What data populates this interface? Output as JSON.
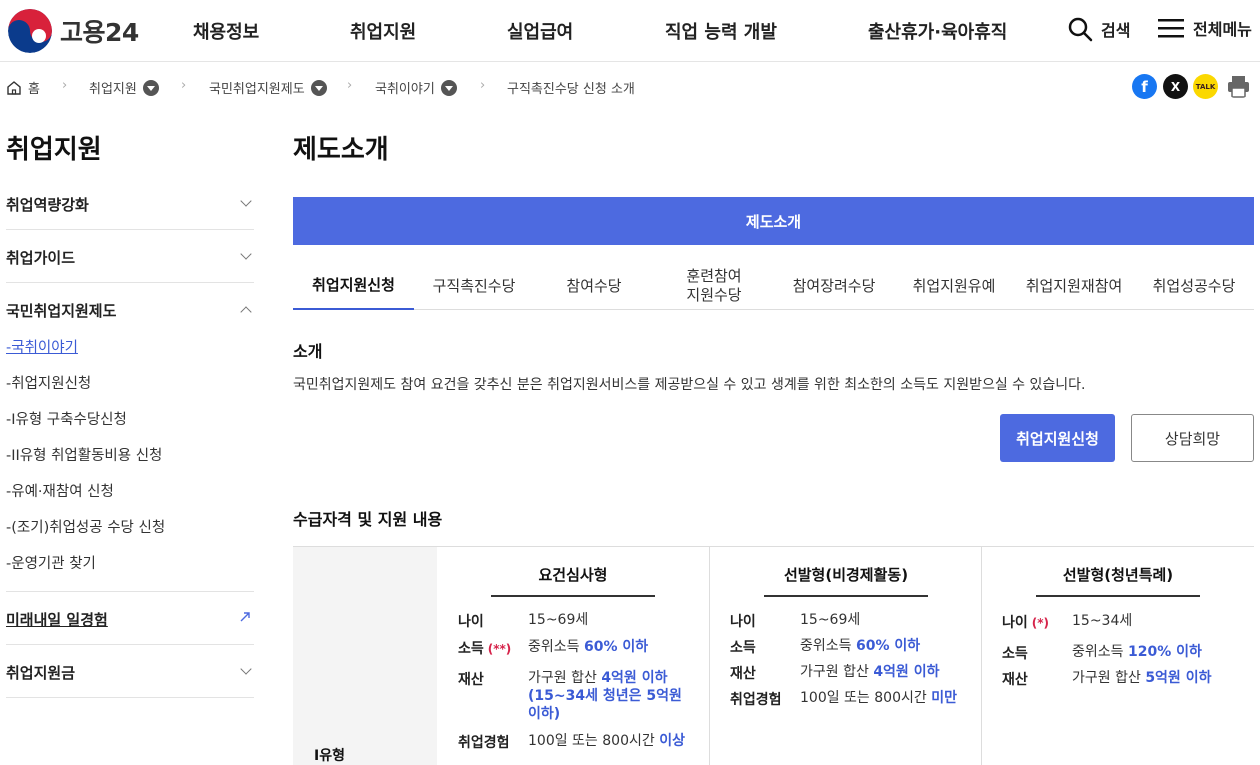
{
  "header": {
    "logo_text": "고용24",
    "nav": [
      "채용정보",
      "취업지원",
      "실업급여",
      "직업 능력 개발",
      "출산휴가·육아휴직"
    ],
    "search_label": "검색",
    "menu_label": "전체메뉴"
  },
  "breadcrumb": {
    "home": "홈",
    "items": [
      "취업지원",
      "국민취업지원제도",
      "국취이야기"
    ],
    "current": "구직촉진수당 신청 소개"
  },
  "share": {
    "facebook": "f",
    "x": "X",
    "kakao": "TALK"
  },
  "sidebar": {
    "title": "취업지원",
    "groups": [
      "취업역량강화",
      "취업가이드",
      "국민취업지원제도"
    ],
    "sub_items": [
      "-국취이야기",
      "-취업지원신청",
      "-I유형 구축수당신청",
      "-II유형 취업활동비용 신청",
      "-유예·재참여 신청",
      "-(조기)취업성공 수당 신청",
      "-운영기관 찾기"
    ],
    "extra": [
      "미래내일 일경험",
      "취업지원금"
    ]
  },
  "main": {
    "page_title": "제도소개",
    "banner": "제도소개",
    "tabs": [
      "취업지원신청",
      "구직촉진수당",
      "참여수당",
      "훈련참여\n지원수당",
      "참여장려수당",
      "취업지원유예",
      "취업지원재참여",
      "취업성공수당"
    ],
    "intro_title": "소개",
    "intro_text": "국민취업지원제도 참여 요건을 갖추신 분은 취업지원서비스를 제공받으실 수 있고 생계를 위한 최소한의 소득도 지원받으실 수 있습니다.",
    "apply_button": "취업지원신청",
    "consult_button": "상담희망",
    "eligibility_title": "수급자격 및 지원 내용"
  },
  "table": {
    "row_label": "I유형",
    "columns": [
      {
        "title": "요건심사형",
        "rows": [
          {
            "k": "나이",
            "v": "15~69세",
            "hl": ""
          },
          {
            "k": "소득",
            "mark": "(**)",
            "v": "중위소득 ",
            "hl": "60% 이하"
          },
          {
            "k": "재산",
            "v": "가구원 합산 ",
            "hl": "4억원 이하 (15~34세 청년은 5억원 이하)"
          },
          {
            "k": "취업경험",
            "v": "100일 또는 800시간 ",
            "hl": "이상"
          }
        ]
      },
      {
        "title": "선발형(비경제활동)",
        "rows": [
          {
            "k": "나이",
            "v": "15~69세",
            "hl": ""
          },
          {
            "k": "소득",
            "v": "중위소득 ",
            "hl": "60% 이하"
          },
          {
            "k": "재산",
            "v": "가구원 합산 ",
            "hl": "4억원 이하"
          },
          {
            "k": "취업경험",
            "v": "100일 또는 800시간 ",
            "hl": "미만"
          }
        ]
      },
      {
        "title": "선발형(청년특례)",
        "rows": [
          {
            "k": "나이",
            "mark": "(*)",
            "v": "15~34세",
            "hl": ""
          },
          {
            "k": "소득",
            "v": "중위소득 ",
            "hl": "120% 이하"
          },
          {
            "k": "재산",
            "v": "가구원 합산 ",
            "hl": "5억원 이하"
          }
        ]
      }
    ]
  },
  "colors": {
    "accent": "#4d6ae0",
    "highlight": "#3b5bd5",
    "required_mark": "#d6234a"
  }
}
